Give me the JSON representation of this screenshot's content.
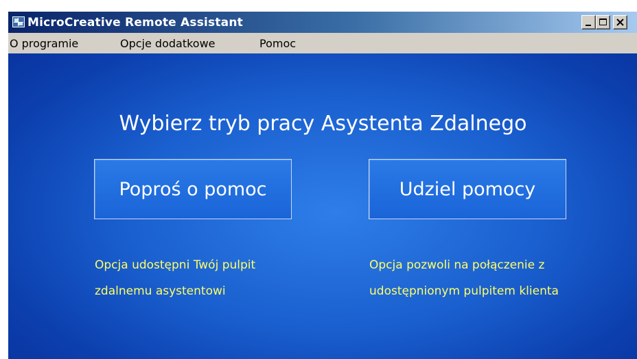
{
  "window": {
    "title": "MicroCreative Remote Assistant",
    "icon": "remote-desktop-icon"
  },
  "title_buttons": {
    "minimize": "minimize-icon",
    "maximize": "maximize-icon",
    "close": "close-icon"
  },
  "menu": {
    "items": [
      {
        "label": "O programie"
      },
      {
        "label": "Opcje dodatkowe"
      },
      {
        "label": "Pomoc"
      }
    ]
  },
  "main": {
    "heading": "Wybierz tryb pracy Asystenta Zdalnego",
    "ask_help": {
      "label": "Poproś o pomoc",
      "desc_line1": "Opcja udostępni Twój pulpit",
      "desc_line2": "zdalnemu asystentowi"
    },
    "give_help": {
      "label": "Udziel pomocy",
      "desc_line1": "Opcja pozwoli na połączenie z",
      "desc_line2": "udostępnionym pulpitem klienta"
    }
  },
  "colors": {
    "background_blue": "#1a5fcf",
    "description_text": "#ffff66",
    "title_gradient_start": "#0a246a"
  }
}
